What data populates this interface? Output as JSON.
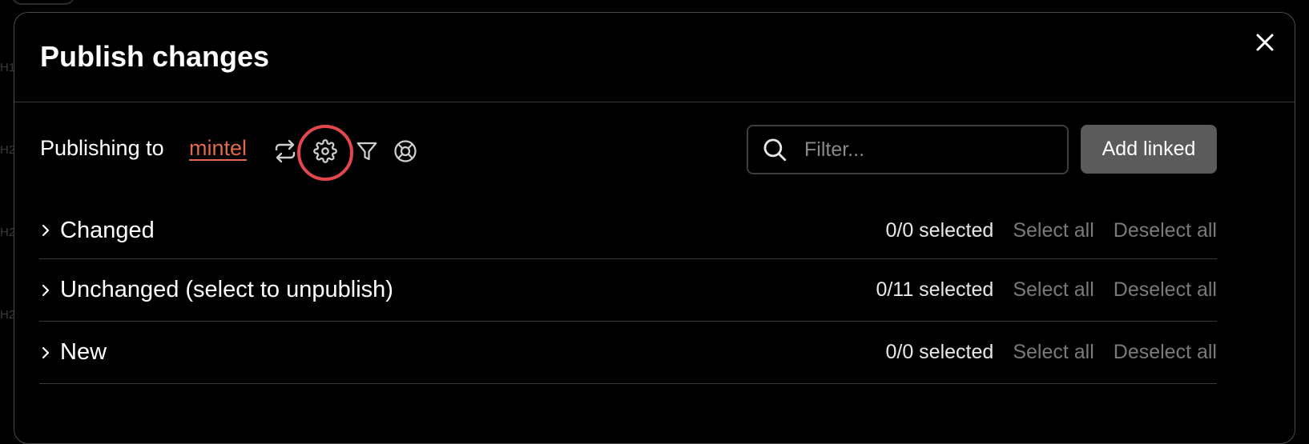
{
  "backdrop": {
    "marks": [
      "H1",
      "H2",
      "H2",
      "H2"
    ]
  },
  "modal": {
    "title": "Publish changes",
    "close_icon": "close-icon"
  },
  "toolbar": {
    "publishing_label": "Publishing to",
    "publishing_target": "mintel",
    "icons": [
      "switch-arrows-icon",
      "gear-icon",
      "filter-funnel-icon",
      "lifebuoy-icon"
    ],
    "highlighted_icon": "gear-icon",
    "filter_placeholder": "Filter...",
    "filter_value": "",
    "add_linked_label": "Add linked"
  },
  "sections": [
    {
      "title": "Changed",
      "count": "0/0 selected",
      "select_all": "Select all",
      "deselect_all": "Deselect all"
    },
    {
      "title": "Unchanged (select to unpublish)",
      "count": "0/11 selected",
      "select_all": "Select all",
      "deselect_all": "Deselect all"
    },
    {
      "title": "New",
      "count": "0/0 selected",
      "select_all": "Select all",
      "deselect_all": "Deselect all"
    }
  ],
  "colors": {
    "accent_link": "#e06a4c",
    "highlight_ring": "#e2474e",
    "button_bg": "#5b5b5b",
    "muted_text": "#7a7a7a"
  }
}
